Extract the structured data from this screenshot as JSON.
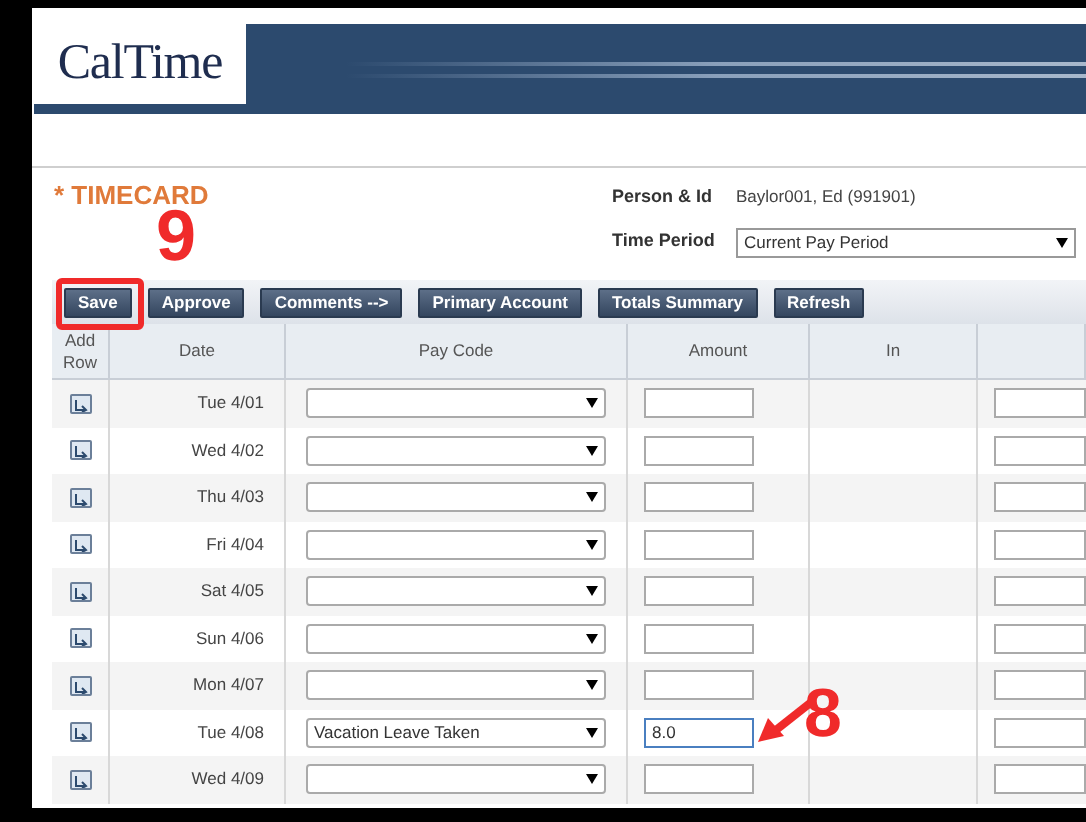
{
  "logo": "CalTime",
  "timecard": {
    "title": "* TIMECARD",
    "person_label": "Person & Id",
    "person_value": "Baylor001, Ed (991901)",
    "period_label": "Time Period",
    "period_value": "Current Pay Period"
  },
  "toolbar": [
    {
      "label": "Save"
    },
    {
      "label": "Approve"
    },
    {
      "label": "Comments -->"
    },
    {
      "label": "Primary Account"
    },
    {
      "label": "Totals Summary"
    },
    {
      "label": "Refresh"
    }
  ],
  "columns": [
    "Add Row",
    "Date",
    "Pay Code",
    "Amount",
    "In"
  ],
  "rows": [
    {
      "date": "Tue 4/01",
      "pay_code": "",
      "amount": "",
      "focused": false
    },
    {
      "date": "Wed 4/02",
      "pay_code": "",
      "amount": "",
      "focused": false
    },
    {
      "date": "Thu 4/03",
      "pay_code": "",
      "amount": "",
      "focused": false
    },
    {
      "date": "Fri 4/04",
      "pay_code": "",
      "amount": "",
      "focused": false
    },
    {
      "date": "Sat 4/05",
      "pay_code": "",
      "amount": "",
      "focused": false
    },
    {
      "date": "Sun 4/06",
      "pay_code": "",
      "amount": "",
      "focused": false
    },
    {
      "date": "Mon 4/07",
      "pay_code": "",
      "amount": "",
      "focused": false
    },
    {
      "date": "Tue 4/08",
      "pay_code": "Vacation Leave Taken",
      "amount": "8.0",
      "focused": true
    },
    {
      "date": "Wed 4/09",
      "pay_code": "",
      "amount": "",
      "focused": false
    }
  ],
  "annotations": [
    {
      "label": "9"
    },
    {
      "label": "8"
    }
  ]
}
